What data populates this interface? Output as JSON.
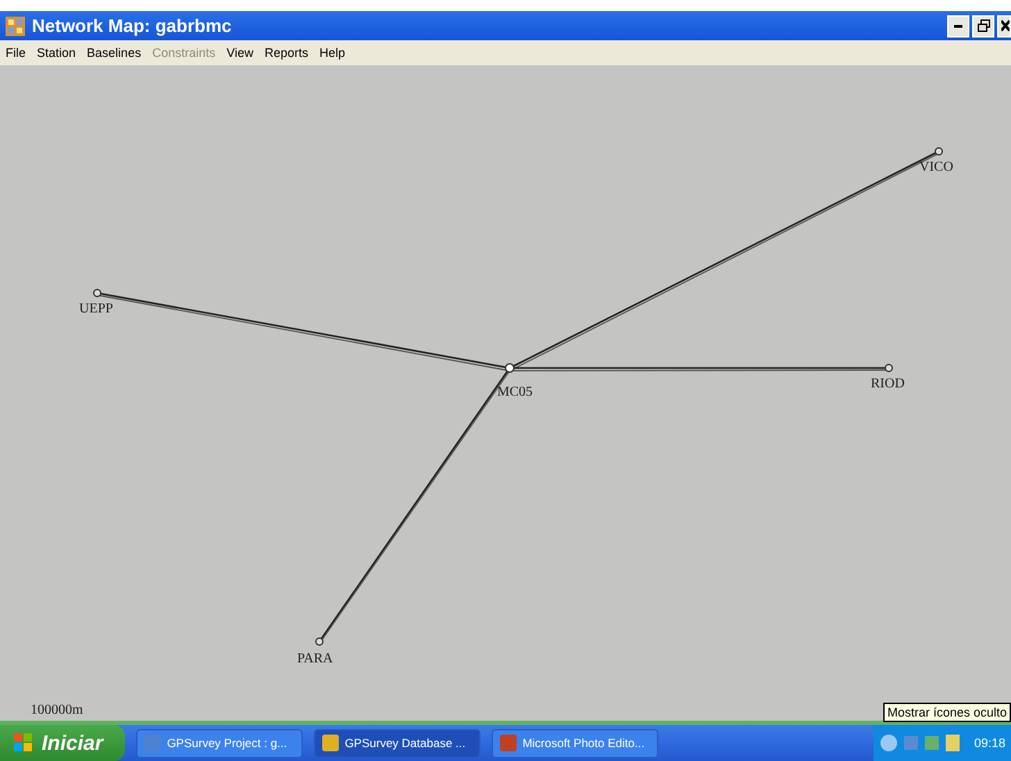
{
  "window": {
    "title": "Network Map: gabrbmc"
  },
  "menu": [
    {
      "label": "File",
      "disabled": false
    },
    {
      "label": "Station",
      "disabled": false
    },
    {
      "label": "Baselines",
      "disabled": false
    },
    {
      "label": "Constraints",
      "disabled": true
    },
    {
      "label": "View",
      "disabled": false
    },
    {
      "label": "Reports",
      "disabled": false
    },
    {
      "label": "Help",
      "disabled": false
    }
  ],
  "map": {
    "hub": "MC05",
    "stations": [
      "VICO",
      "UEPP",
      "RIOD",
      "PARA"
    ],
    "scale": "100000m"
  },
  "taskbar": {
    "start": "Iniciar",
    "tasks": [
      {
        "label": "GPSurvey Project : g...",
        "selected": false
      },
      {
        "label": "GPSurvey Database ...",
        "selected": true
      },
      {
        "label": "Microsoft Photo Edito...",
        "selected": false
      }
    ],
    "tooltip": "Mostrar ícones oculto",
    "clock": "09:18"
  }
}
